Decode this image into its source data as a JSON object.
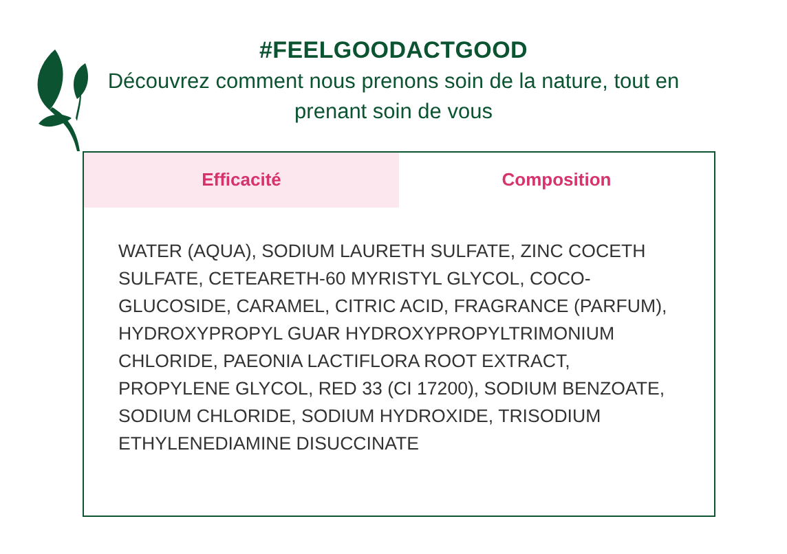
{
  "header": {
    "title": "#FEELGOODACTGOOD",
    "subtitle": "Découvrez comment nous prenons soin de la nature, tout en prenant soin de vous"
  },
  "tabs": [
    {
      "label": "Efficacité",
      "selected": false
    },
    {
      "label": "Composition",
      "selected": true
    }
  ],
  "content": "WATER (AQUA), SODIUM LAURETH SULFATE, ZINC COCETH SULFATE, CETEARETH-60 MYRISTYL GLYCOL, COCO-GLUCOSIDE, CARAMEL, CITRIC ACID, FRAGRANCE (PARFUM), HYDROXYPROPYL GUAR HYDROXYPROPYLTRIMONIUM CHLORIDE, PAEONIA LACTIFLORA ROOT EXTRACT, PROPYLENE GLYCOL, RED 33 (CI 17200), SODIUM BENZOATE, SODIUM CHLORIDE, SODIUM HYDROXIDE, TRISODIUM ETHYLENEDIAMINE DISUCCINATE"
}
